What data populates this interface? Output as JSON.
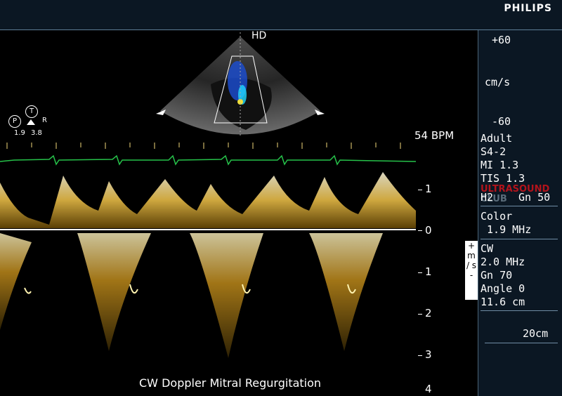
{
  "header": {
    "brand": "PHILIPS"
  },
  "image2d": {
    "orientation_marker": "HD"
  },
  "patient_marker": {
    "p": "P",
    "t": "T",
    "r": "R",
    "v1": "1.9",
    "v2": "3.8"
  },
  "color_bar": {
    "top": "+60",
    "units": "cm/s",
    "bottom": "-60",
    "colors": [
      "#ffff00",
      "#ff8800",
      "#7b2a00",
      "#000000",
      "#003d8f",
      "#0066ff",
      "#00e5ff"
    ]
  },
  "heart_rate": "54 BPM",
  "settings": {
    "patient": "Adult",
    "probe": "S4-2",
    "mi": "MI 1.3",
    "tis": "TIS 1.3",
    "hi": "H2",
    "gain2d": "Gn 50",
    "color_mode": "Color",
    "color_freq": " 1.9 MHz",
    "cw_mode": "CW",
    "cw_freq": "2.0 MHz",
    "cw_gain": "Gn 70",
    "angle": "Angle 0",
    "depth": "11.6 cm",
    "sweep": "20cm"
  },
  "velocity_scale": {
    "labels": [
      "1",
      "0",
      "1",
      "2",
      "3",
      "4"
    ],
    "units": "+ m / s -"
  },
  "watermark": {
    "line1": "ULTRASOUND",
    "line2": "CLUB"
  },
  "caption": "CW Doppler Mitral Regurgitation"
}
